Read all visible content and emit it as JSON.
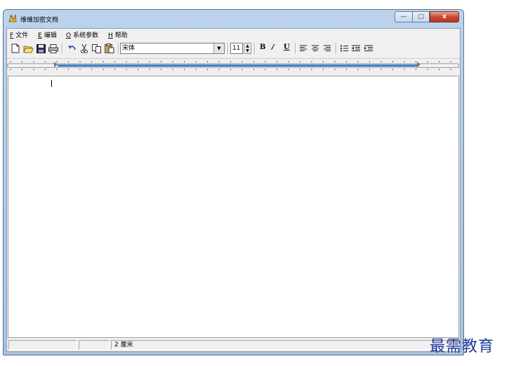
{
  "window": {
    "title": "维维加密文档",
    "controls": {
      "minimize": "—",
      "maximize": "▢",
      "close": "x"
    }
  },
  "menu": {
    "items": [
      {
        "mnemonic": "F",
        "label": "文件"
      },
      {
        "mnemonic": "E",
        "label": "编辑"
      },
      {
        "mnemonic": "O",
        "label": "系统参数"
      },
      {
        "mnemonic": "H",
        "label": "帮助"
      }
    ]
  },
  "toolbar": {
    "font_name": "宋体",
    "font_size": "11",
    "bold": "B",
    "italic": "/",
    "underline": "U"
  },
  "status": {
    "pane3": "2 厘米"
  },
  "watermark": "最需教育",
  "colors": {
    "accent": "#3b7fd6",
    "watermark": "#1f3a9b"
  }
}
